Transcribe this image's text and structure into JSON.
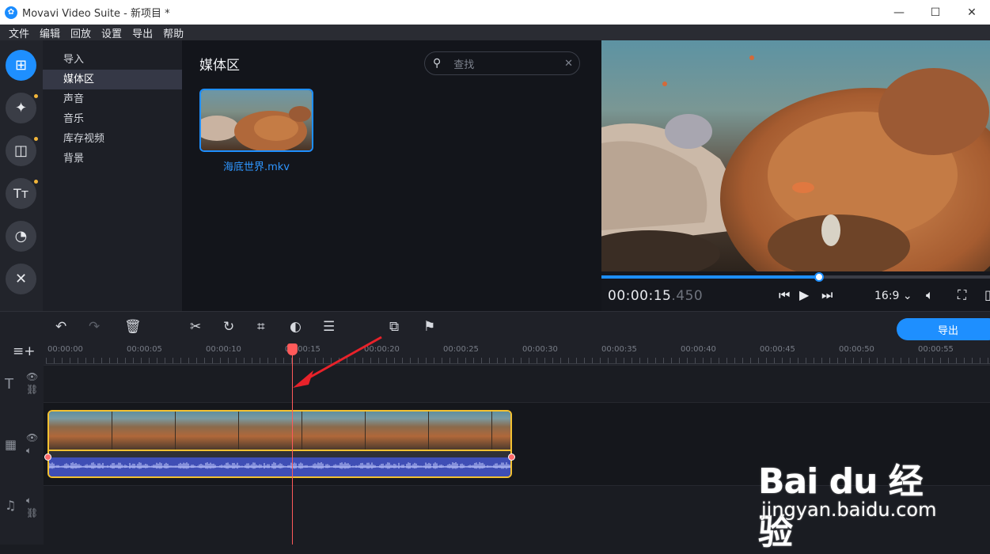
{
  "window": {
    "title": "Movavi Video Suite - 新项目 *"
  },
  "menu": [
    "文件",
    "编辑",
    "回放",
    "设置",
    "导出",
    "帮助"
  ],
  "categories": [
    {
      "label": "导入",
      "selected": false
    },
    {
      "label": "媒体区",
      "selected": true
    },
    {
      "label": "声音",
      "selected": false
    },
    {
      "label": "音乐",
      "selected": false
    },
    {
      "label": "库存视频",
      "selected": false
    },
    {
      "label": "背景",
      "selected": false
    }
  ],
  "media": {
    "title": "媒体区",
    "search_placeholder": "查找",
    "file_name": "海底世界.mkv"
  },
  "preview": {
    "timecode_main": "00:00:15",
    "timecode_ms": ".450",
    "aspect_ratio": "16:9",
    "progress": 0.56
  },
  "toolbar": {
    "export_label": "导出"
  },
  "ruler_ticks": [
    "00:00:00",
    "00:00:05",
    "00:00:10",
    "00:00:15",
    "00:00:20",
    "00:00:25",
    "00:00:30",
    "00:00:35",
    "00:00:40",
    "00:00:45",
    "00:00:50",
    "00:00:55"
  ],
  "watermark": {
    "brand": "Bai du 经验",
    "url": "jingyan.baidu.com"
  },
  "colors": {
    "accent": "#1e8fff",
    "clip_border": "#f3c131",
    "playhead": "#ff5a5a",
    "audio": "#3f4eb5"
  }
}
